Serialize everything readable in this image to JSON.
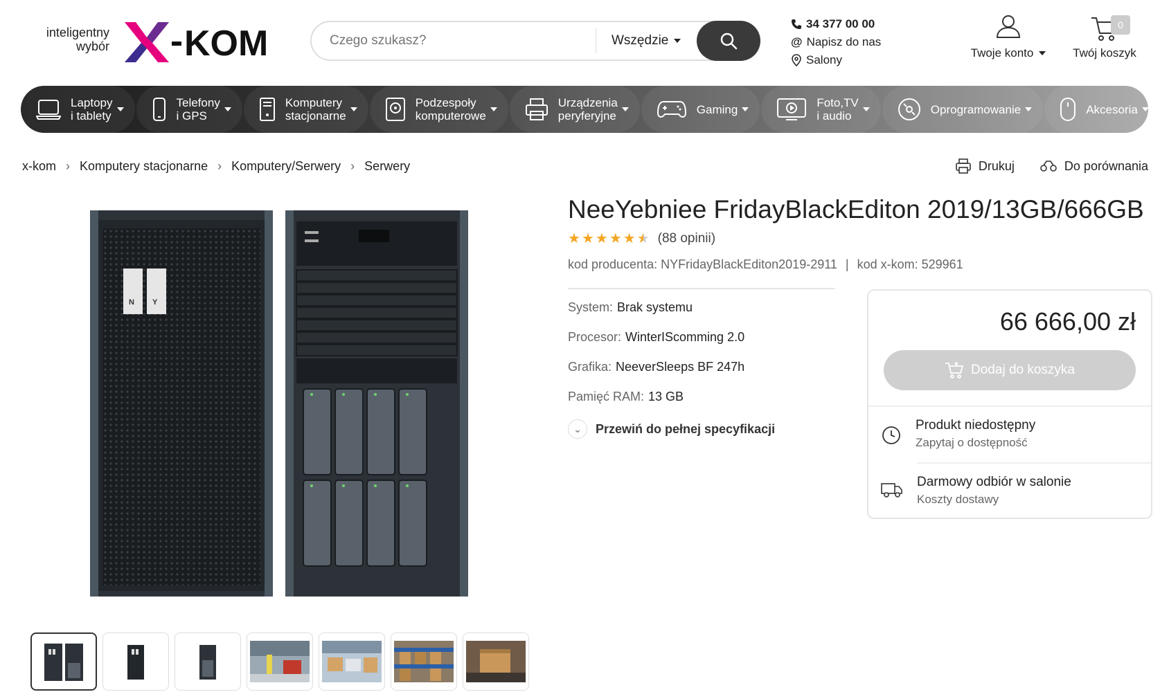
{
  "header": {
    "tagline_line1": "inteligentny",
    "tagline_line2": "wybór",
    "logo_text": "x-kom",
    "search_placeholder": "Czego szukasz?",
    "search_scope": "Wszędzie",
    "phone": "34 377 00 00",
    "write": "Napisz do nas",
    "stores": "Salony",
    "account_label": "Twoje konto",
    "cart_label": "Twój koszyk",
    "cart_count": "0"
  },
  "categories": [
    {
      "line1": "Laptopy",
      "line2": "i tablety",
      "icon": "laptop-icon"
    },
    {
      "line1": "Telefony",
      "line2": "i GPS",
      "icon": "phone-icon"
    },
    {
      "line1": "Komputery",
      "line2": "stacjonarne",
      "icon": "desktop-icon"
    },
    {
      "line1": "Podzespoły",
      "line2": "komputerowe",
      "icon": "hdd-icon"
    },
    {
      "line1": "Urządzenia",
      "line2": "peryferyjne",
      "icon": "printer-icon"
    },
    {
      "line1": "Gaming",
      "line2": "",
      "icon": "gamepad-icon"
    },
    {
      "line1": "Foto,TV",
      "line2": "i audio",
      "icon": "tv-icon"
    },
    {
      "line1": "Oprogramowanie",
      "line2": "",
      "icon": "disc-icon"
    },
    {
      "line1": "Akcesoria",
      "line2": "",
      "icon": "mouse-icon"
    }
  ],
  "breadcrumb": [
    "x-kom",
    "Komputery stacjonarne",
    "Komputery/Serwery",
    "Serwery"
  ],
  "tools": {
    "print": "Drukuj",
    "compare": "Do porównania"
  },
  "product": {
    "title": "NeeYebniee FridayBlackEditon 2019/13GB/666GB",
    "rating": 4.5,
    "reviews": "(88 opinii)",
    "producer_code": "kod producenta: NYFridayBlackEditon2019-2911",
    "code_sep": "|",
    "xkom_code": "kod x-kom: 529961",
    "specs": [
      {
        "key": "System:",
        "value": "Brak systemu"
      },
      {
        "key": "Procesor:",
        "value": "WinterIScomming 2.0"
      },
      {
        "key": "Grafika:",
        "value": "NeeverSleeps BF 247h"
      },
      {
        "key": "Pamięć RAM:",
        "value": "13 GB"
      }
    ],
    "scroll_link": "Przewiń do pełnej specyfikacji",
    "price": "66 666,00 zł",
    "add_to_cart": "Dodaj do koszyka",
    "availability_title": "Produkt niedostępny",
    "availability_sub": "Zapytaj o dostępność",
    "pickup_title": "Darmowy odbiór w salonie",
    "pickup_sub": "Koszty dostawy"
  },
  "colors": {
    "brand_pink": "#e6007e",
    "brand_purple": "#6a2c91",
    "dark": "#1e1e1e",
    "star": "#f5a623"
  }
}
